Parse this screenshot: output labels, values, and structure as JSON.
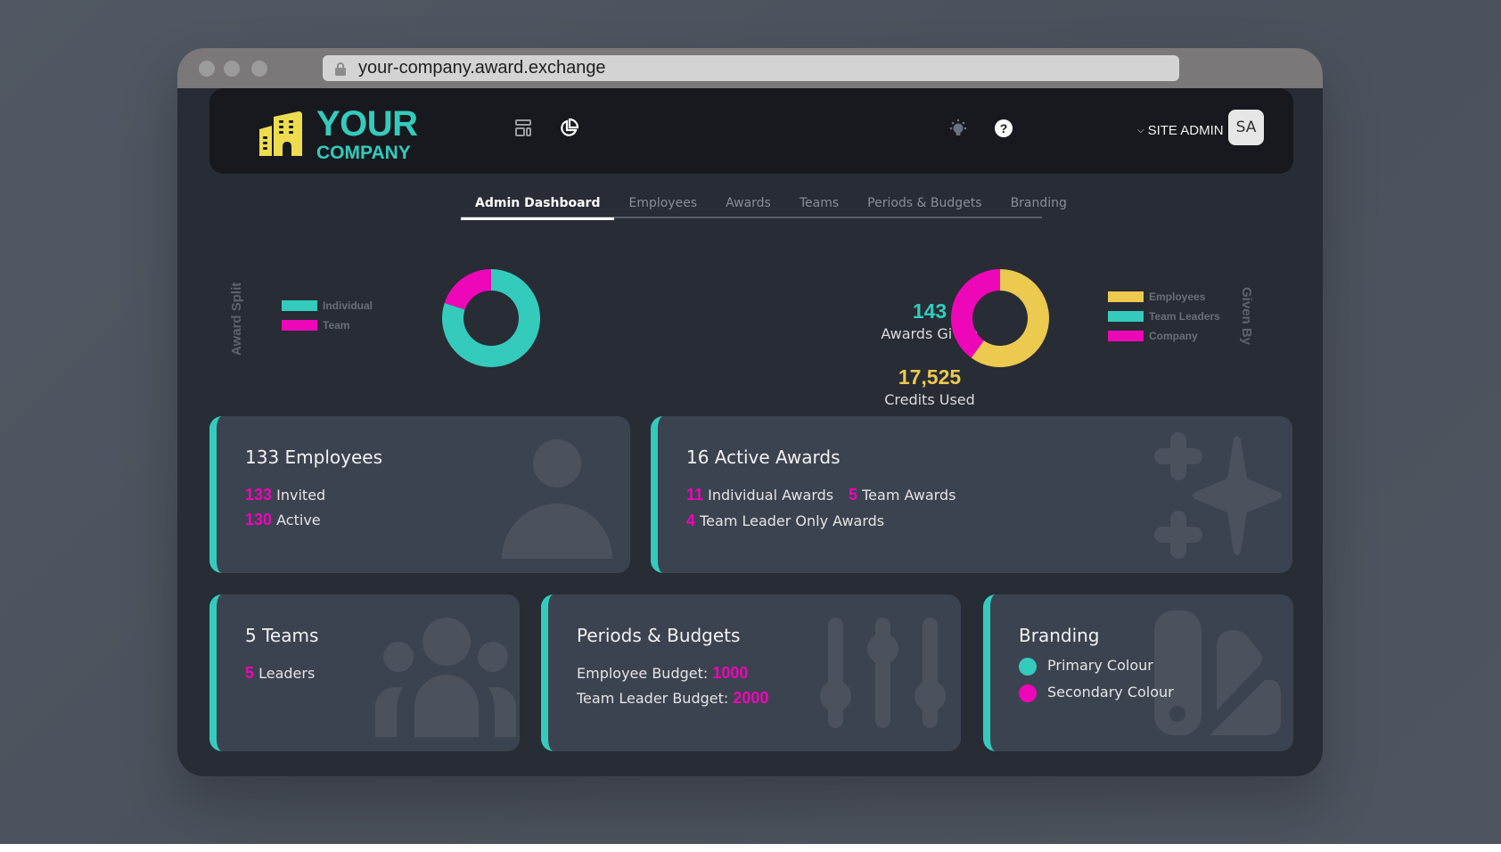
{
  "browser": {
    "url": "your-company.award.exchange"
  },
  "header": {
    "logo_line1": "YOUR",
    "logo_line2": "COMPANY",
    "nav_icons": [
      "layout-icon",
      "pie-chart-icon"
    ],
    "theme_icon": "lightbulb-icon",
    "help_icon": "help-icon",
    "user_menu_label": "SITE ADMIN",
    "avatar_initials": "SA"
  },
  "tabs": [
    {
      "label": "Admin Dashboard",
      "active": true
    },
    {
      "label": "Employees",
      "active": false
    },
    {
      "label": "Awards",
      "active": false
    },
    {
      "label": "Teams",
      "active": false
    },
    {
      "label": "Periods & Budgets",
      "active": false
    },
    {
      "label": "Branding",
      "active": false
    }
  ],
  "colors": {
    "primary": "#34cbbd",
    "secondary": "#ee06b9",
    "accent_yellow": "#ecc94f"
  },
  "stats": {
    "awards_given_value": "143",
    "awards_given_label": "Awards Given",
    "credits_used_value": "17,525",
    "credits_used_label": "Credits Used"
  },
  "chart_data": [
    {
      "type": "pie",
      "title": "Award Split",
      "donut": true,
      "legend_position": "left",
      "labels": [
        "Individual",
        "Team"
      ],
      "values": [
        80,
        20
      ],
      "colors": [
        "#34cbbd",
        "#ee06b9"
      ]
    },
    {
      "type": "pie",
      "title": "Given By",
      "donut": true,
      "legend_position": "right",
      "labels": [
        "Employees",
        "Team Leaders",
        "Company"
      ],
      "values": [
        60,
        0,
        40
      ],
      "colors": [
        "#ecc94f",
        "#34cbbd",
        "#ee06b9"
      ]
    }
  ],
  "cards": {
    "employees": {
      "title": "133 Employees",
      "invited_value": "133",
      "invited_label": "Invited",
      "active_value": "130",
      "active_label": "Active"
    },
    "awards": {
      "title": "16 Active Awards",
      "individual_value": "11",
      "individual_label": "Individual Awards",
      "team_value": "5",
      "team_label": "Team Awards",
      "leader_value": "4",
      "leader_label": "Team Leader Only Awards"
    },
    "teams": {
      "title": "5 Teams",
      "leaders_value": "5",
      "leaders_label": "Leaders"
    },
    "budgets": {
      "title": "Periods & Budgets",
      "employee_label": "Employee Budget:",
      "employee_value": "1000",
      "leader_label": "Team Leader Budget:",
      "leader_value": "2000"
    },
    "branding": {
      "title": "Branding",
      "primary_label": "Primary Colour",
      "secondary_label": "Secondary Colour"
    }
  }
}
